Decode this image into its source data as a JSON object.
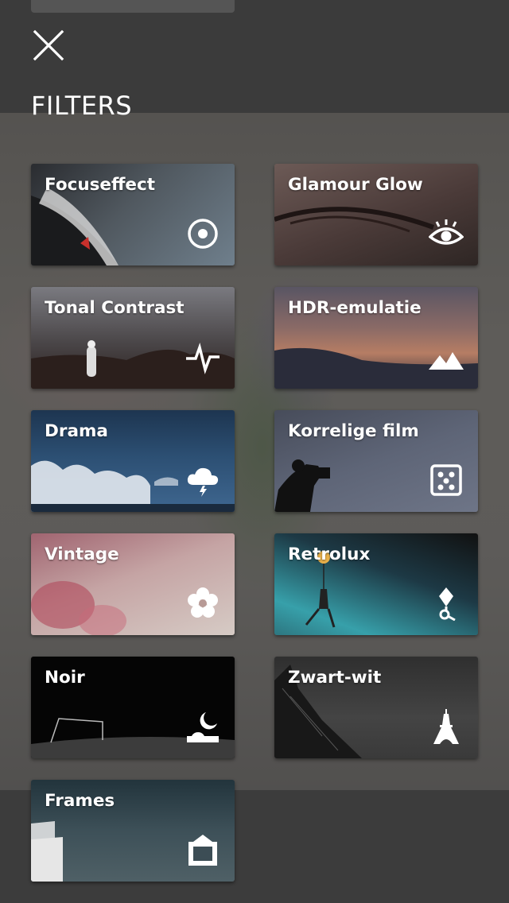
{
  "header": {
    "title": "FILTERS",
    "close_icon": "close-icon"
  },
  "filters": [
    {
      "label": "Focuseffect",
      "icon": "target-icon"
    },
    {
      "label": "Glamour Glow",
      "icon": "eye-icon"
    },
    {
      "label": "Tonal Contrast",
      "icon": "pulse-icon"
    },
    {
      "label": "HDR-emulatie",
      "icon": "mountains-icon"
    },
    {
      "label": "Drama",
      "icon": "storm-cloud-icon"
    },
    {
      "label": "Korrelige film",
      "icon": "dice-icon"
    },
    {
      "label": "Vintage",
      "icon": "flower-icon"
    },
    {
      "label": "Retrolux",
      "icon": "balloon-icon"
    },
    {
      "label": "Noir",
      "icon": "moon-icon"
    },
    {
      "label": "Zwart-wit",
      "icon": "eiffel-tower-icon"
    },
    {
      "label": "Frames",
      "icon": "frame-icon"
    }
  ],
  "colors": {
    "background": "#3a3a3a",
    "text": "#ffffff"
  }
}
